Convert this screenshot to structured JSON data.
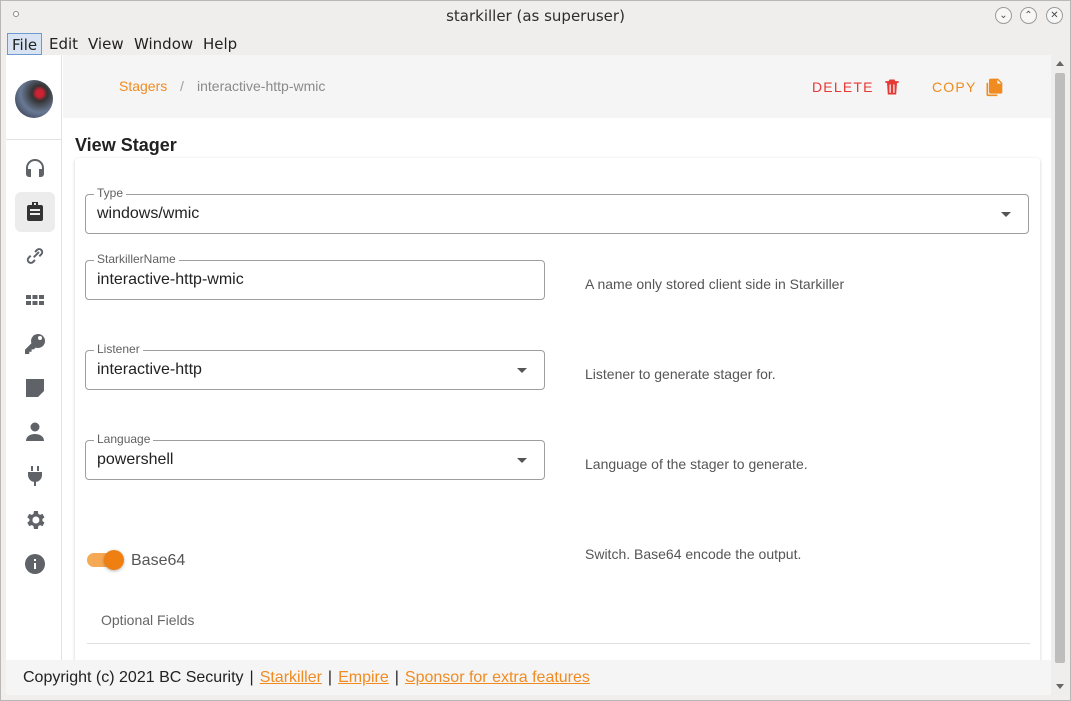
{
  "window": {
    "title": "starkiller (as superuser)"
  },
  "menu": [
    "File",
    "Edit",
    "View",
    "Window",
    "Help"
  ],
  "breadcrumb": {
    "parent": "Stagers",
    "separator": "/",
    "current": "interactive-http-wmic"
  },
  "actions": {
    "delete": "DELETE",
    "copy": "COPY"
  },
  "page": {
    "title": "View Stager"
  },
  "form": {
    "type": {
      "label": "Type",
      "value": "windows/wmic"
    },
    "name": {
      "label": "StarkillerName",
      "value": "interactive-http-wmic",
      "hint": "A name only stored client side in Starkiller"
    },
    "listener": {
      "label": "Listener",
      "value": "interactive-http",
      "hint": "Listener to generate stager for."
    },
    "language": {
      "label": "Language",
      "value": "powershell",
      "hint": "Language of the stager to generate."
    },
    "base64": {
      "label": "Base64",
      "on": true,
      "hint": "Switch. Base64 encode the output."
    },
    "optional": "Optional Fields"
  },
  "footer": {
    "copyright": "Copyright (c) 2021 BC Security",
    "sep": "|",
    "links": [
      "Starkiller",
      "Empire",
      "Sponsor for extra features"
    ]
  },
  "sidebar": {
    "icons": [
      "headphones-icon",
      "briefcase-icon",
      "link-icon",
      "grid-icon",
      "key-icon",
      "note-icon",
      "user-icon",
      "plug-icon",
      "gear-icon",
      "info-icon"
    ],
    "active": "briefcase-icon"
  },
  "colors": {
    "accent": "#f08b21",
    "delete": "#e53935"
  }
}
